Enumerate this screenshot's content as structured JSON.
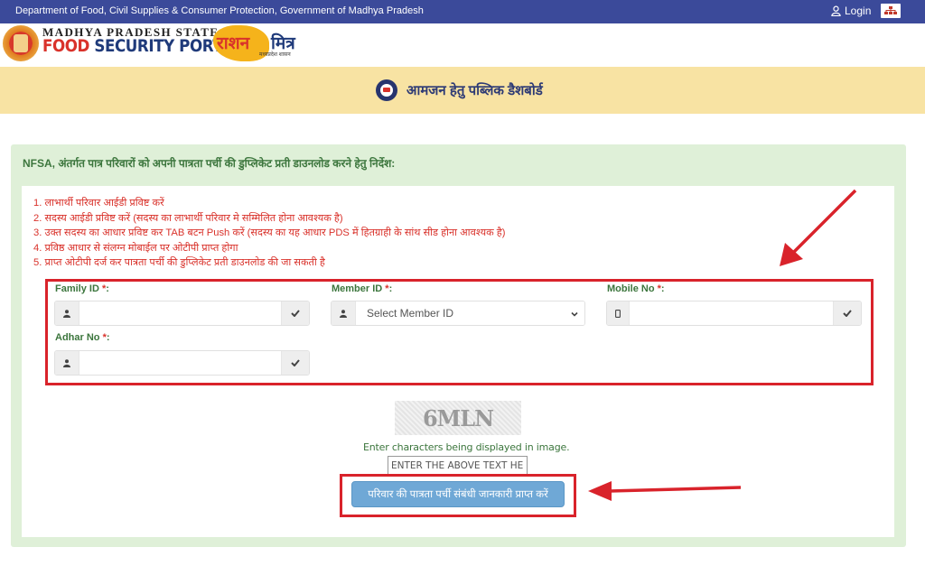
{
  "topbar": {
    "department": "Department of Food, Civil Supplies & Consumer Protection, Government of Madhya Pradesh",
    "login_label": "Login",
    "login_icon": "user-icon",
    "sitemap_icon": "sitemap-icon"
  },
  "branding": {
    "state": "MADHYA PRADESH STATE",
    "portal_word1": "FOOD",
    "portal_rest": "SECURITY PORTAL",
    "ration": "राशन",
    "mitra": "मित्र",
    "mitra_sub": "मध्यप्रदेश शासन"
  },
  "dashboard": {
    "title": "आमजन हेतु पब्लिक डैशबोर्ड"
  },
  "panel": {
    "heading_prefix": "NFSA",
    "heading": ", अंतर्गत पात्र परिवारों को अपनी पात्रता पर्ची की डुप्लिकेट प्रती डाउनलोड करने हेतु निर्देश:",
    "instructions": [
      "1. लाभार्थी परिवार आईडी प्रविष्ट करें",
      "2. सदस्य आईडी प्रविष्ट करें (सदस्य का लाभार्थी परिवार मे सम्मिलित होना आवश्यक है)",
      "3. उक्त सदस्य का आधार प्रविष्ट कर TAB बटन Push करें (सदस्य का यह आधार PDS में हितग्राही के सांथ सीड होना आवश्यक है)",
      "4. प्रविष्ठ आधार से संलग्न मोबाईल पर ओटीपी प्राप्त होगा",
      "5. प्राप्त ओटीपी दर्ज कर पात्रता पर्ची की डुप्लिकेट प्रती डाउनलोड की जा सकती है"
    ]
  },
  "form": {
    "family_id": {
      "label": "Family ID ",
      "required": "*",
      "suffix": ":",
      "value": ""
    },
    "member_id": {
      "label": "Member ID ",
      "required": "*",
      "suffix": ":",
      "selected": "Select Member ID"
    },
    "mobile_no": {
      "label": "Mobile No ",
      "required": "*",
      "suffix": ":",
      "value": ""
    },
    "adhar_no": {
      "label": "Adhar No ",
      "required": "*",
      "suffix": ":",
      "value": ""
    }
  },
  "captcha": {
    "text": "6MLN",
    "hint": "Enter characters being displayed in image.",
    "placeholder": "ENTER THE ABOVE TEXT HERE"
  },
  "submit": {
    "label": "परिवार की पात्रता पर्ची संबंधी जानकारी प्राप्त करें"
  },
  "colors": {
    "topbar": "#3b4a9a",
    "dashboard_band": "#f8e3a3",
    "panel": "#dff0d8",
    "label_green": "#3c763d",
    "instruction_red": "#d9322b",
    "highlight_red": "#d9232b",
    "button_blue": "#6fa8d6"
  }
}
